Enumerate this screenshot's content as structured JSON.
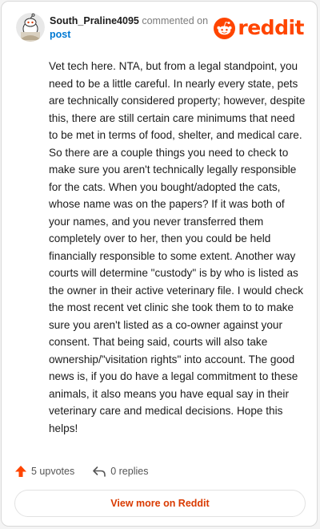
{
  "comment": {
    "author": "South_Praline4095",
    "action_text": "commented on",
    "post_link_text": "post",
    "body": "Vet tech here. NTA, but from a legal standpoint, you need to be a little careful. In nearly every state, pets are technically considered property; however, despite this, there are still certain care minimums that need to be met in terms of food, shelter, and medical care. So there are a couple things you need to check to make sure you aren't technically legally responsible for the cats. When you bought/adopted the cats, whose name was on the papers? If it was both of your names, and you never transferred them completely over to her, then you could be held financially responsible to some extent. Another way courts will determine \"custody\" is by who is listed as the owner in their active veterinary file. I would check the most recent vet clinic she took them to to make sure you aren't listed as a co-owner against your consent. That being said, courts will also take ownership/\"visitation rights\" into account. The good news is, if you do have a legal commitment to these animals, it also means you have equal say in their veterinary care and medical decisions. Hope this helps!",
    "upvotes_text": "5 upvotes",
    "replies_text": "0 replies"
  },
  "brand": {
    "name": "reddit",
    "color": "#ff4500"
  },
  "footer": {
    "view_more_label": "View more on Reddit",
    "view_more_color": "#d93a00"
  },
  "icons": {
    "avatar": "snoo-avatar-icon",
    "logo": "reddit-alien-icon",
    "upvote": "upvote-arrow-icon",
    "reply": "reply-arrow-icon"
  }
}
